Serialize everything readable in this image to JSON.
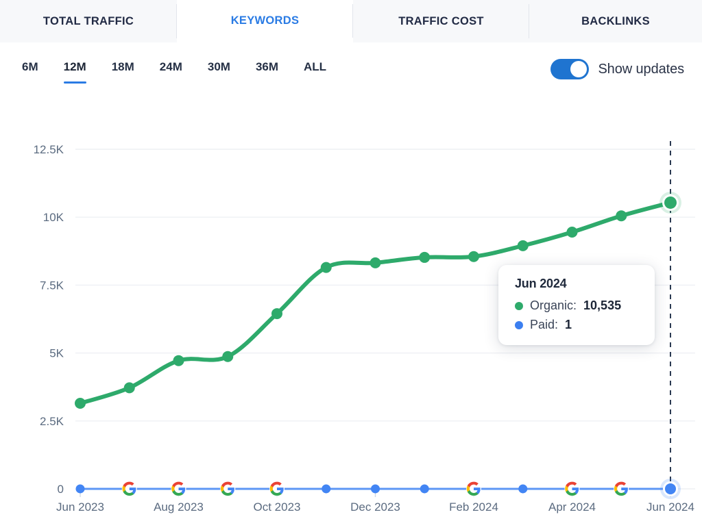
{
  "tabs": [
    {
      "label": "TOTAL TRAFFIC",
      "active": false
    },
    {
      "label": "KEYWORDS",
      "active": true
    },
    {
      "label": "TRAFFIC COST",
      "active": false
    },
    {
      "label": "BACKLINKS",
      "active": false
    }
  ],
  "ranges": [
    {
      "label": "6M",
      "active": false
    },
    {
      "label": "12M",
      "active": true
    },
    {
      "label": "18M",
      "active": false
    },
    {
      "label": "24M",
      "active": false
    },
    {
      "label": "30M",
      "active": false
    },
    {
      "label": "36M",
      "active": false
    },
    {
      "label": "ALL",
      "active": false
    }
  ],
  "updates_toggle": {
    "label": "Show updates",
    "state": "on",
    "icon": "toggle-switch-on"
  },
  "tooltip": {
    "title": "Jun 2024",
    "organic_label": "Organic:",
    "organic_value": "10,535",
    "paid_label": "Paid:",
    "paid_value": "1",
    "organic_color": "#2eaa6b",
    "paid_color": "#3b7ff0"
  },
  "colors": {
    "organic": "#2eaa6b",
    "paid": "#4285f4",
    "accent": "#2a7be4",
    "grid": "#eef0f4",
    "axis_text": "#5b6b80",
    "marker_line": "#2b3a52"
  },
  "chart_data": {
    "type": "line",
    "title": "",
    "xlabel": "",
    "ylabel": "",
    "ylim": [
      0,
      12500
    ],
    "grid": true,
    "legend": "none",
    "y_ticks": [
      "0",
      "2.5K",
      "5K",
      "7.5K",
      "10K",
      "12.5K"
    ],
    "y_tick_values": [
      0,
      2500,
      5000,
      7500,
      10000,
      12500
    ],
    "x": [
      "Jun 2023",
      "Jul 2023",
      "Aug 2023",
      "Sep 2023",
      "Oct 2023",
      "Nov 2023",
      "Dec 2023",
      "Jan 2024",
      "Feb 2024",
      "Mar 2024",
      "Apr 2024",
      "May 2024",
      "Jun 2024"
    ],
    "x_tick_labels": [
      "Jun 2023",
      "Aug 2023",
      "Oct 2023",
      "Dec 2023",
      "Feb 2024",
      "Apr 2024",
      "Jun 2024"
    ],
    "series": [
      {
        "name": "Organic",
        "color": "#2eaa6b",
        "values": [
          3150,
          3720,
          4720,
          4870,
          6450,
          8150,
          8320,
          8520,
          8550,
          8950,
          9450,
          10050,
          10535
        ]
      },
      {
        "name": "Paid",
        "color": "#4285f4",
        "values": [
          1,
          1,
          1,
          1,
          1,
          1,
          1,
          1,
          1,
          1,
          1,
          1,
          1
        ]
      }
    ],
    "google_updates": {
      "icon": "google-g-icon",
      "label": "Google update",
      "at_indices": [
        1,
        2,
        3,
        4,
        8,
        10,
        11
      ]
    },
    "highlighted_index": 12,
    "highlight_line": "dashed"
  }
}
